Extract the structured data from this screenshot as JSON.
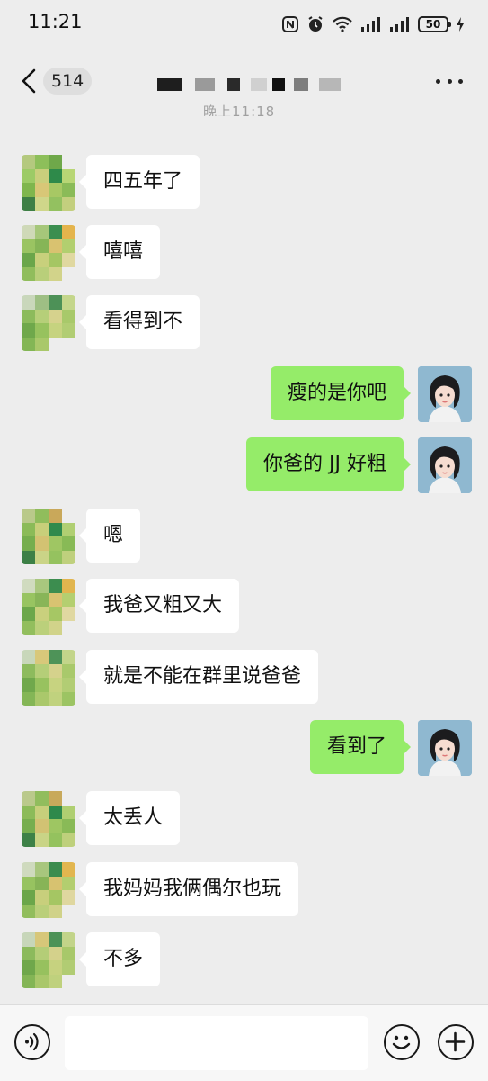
{
  "status_bar": {
    "time": "11:21",
    "battery": "50"
  },
  "header": {
    "unread_count": "514"
  },
  "timestamp_partial": "晚上11:18",
  "messages": [
    {
      "side": "left",
      "text": "四五年了"
    },
    {
      "side": "left",
      "text": "嘻嘻"
    },
    {
      "side": "left",
      "text": "看得到不"
    },
    {
      "side": "right",
      "text": "瘦的是你吧"
    },
    {
      "side": "right",
      "text": "你爸的 JJ 好粗"
    },
    {
      "side": "left",
      "text": "嗯"
    },
    {
      "side": "left",
      "text": "我爸又粗又大"
    },
    {
      "side": "left",
      "text": "就是不能在群里说爸爸"
    },
    {
      "side": "right",
      "text": "看到了"
    },
    {
      "side": "left",
      "text": "太丢人"
    },
    {
      "side": "left",
      "text": "我妈妈我俩偶尔也玩"
    },
    {
      "side": "left",
      "text": "不多"
    }
  ],
  "input": {
    "placeholder": ""
  },
  "icons": {
    "back": "chevron-left-icon",
    "more": "more-dots-icon",
    "voice": "voice-icon",
    "emoji": "emoji-icon",
    "plus": "plus-icon"
  },
  "colors": {
    "background": "#ededed",
    "self_bubble": "#95ec69",
    "other_bubble": "#ffffff"
  }
}
